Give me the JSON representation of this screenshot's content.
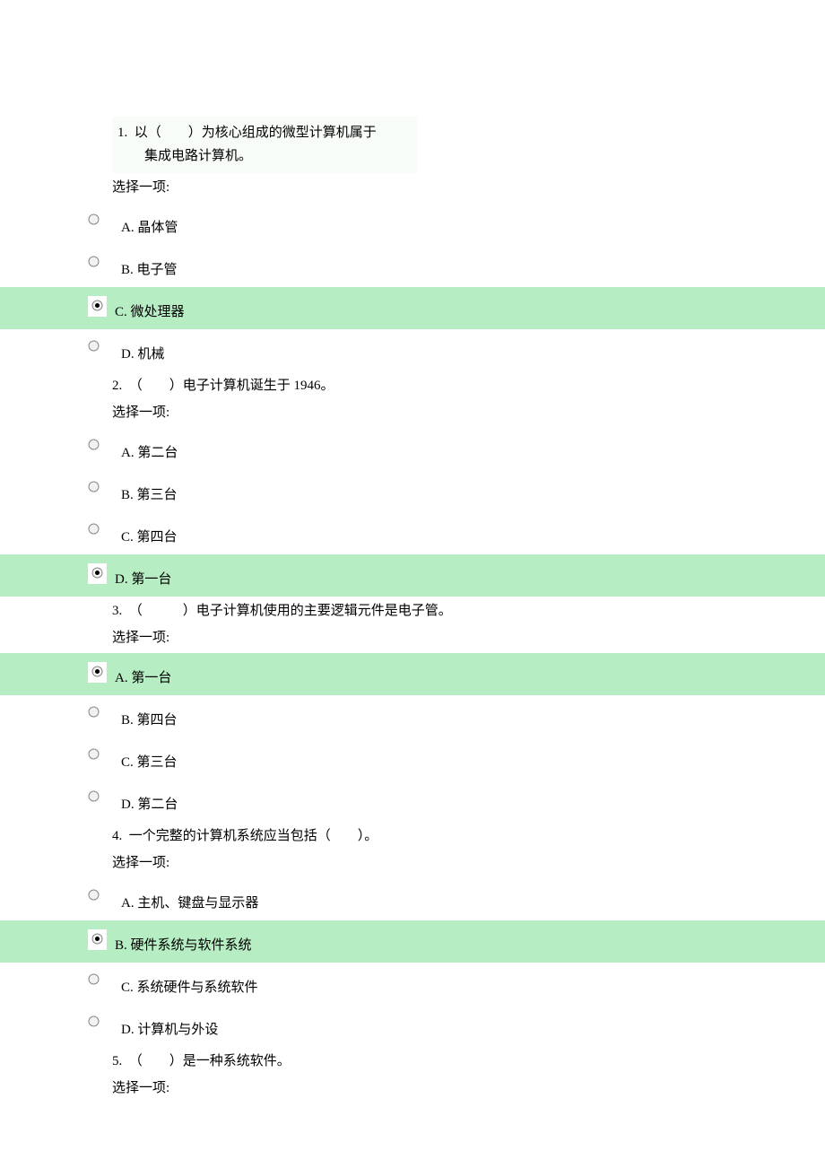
{
  "select_label": "选择一项:",
  "questions": [
    {
      "num": "1.",
      "line1": "以（　　）为核心组成的微型计算机属于",
      "line2": "集成电路计算机。",
      "boxed": true,
      "options": [
        {
          "letter": "A.",
          "text": "晶体管",
          "selected": false
        },
        {
          "letter": "B.",
          "text": "电子管",
          "selected": false
        },
        {
          "letter": "C.",
          "text": "微处理器",
          "selected": true
        },
        {
          "letter": "D.",
          "text": "机械",
          "selected": false
        }
      ]
    },
    {
      "num": "2.",
      "line1": "（　　）电子计算机诞生于 1946。",
      "boxed": false,
      "options": [
        {
          "letter": "A.",
          "text": "第二台",
          "selected": false
        },
        {
          "letter": "B.",
          "text": "第三台",
          "selected": false
        },
        {
          "letter": "C.",
          "text": "第四台",
          "selected": false
        },
        {
          "letter": "D.",
          "text": "第一台",
          "selected": true
        }
      ]
    },
    {
      "num": "3.",
      "line1": "（　　　）电子计算机使用的主要逻辑元件是电子管。",
      "boxed": false,
      "options": [
        {
          "letter": "A.",
          "text": "第一台",
          "selected": true
        },
        {
          "letter": "B.",
          "text": "第四台",
          "selected": false
        },
        {
          "letter": "C.",
          "text": "第三台",
          "selected": false
        },
        {
          "letter": "D.",
          "text": "第二台",
          "selected": false
        }
      ]
    },
    {
      "num": "4.",
      "line1": "一个完整的计算机系统应当包括（　　）。",
      "boxed": false,
      "options": [
        {
          "letter": "A.",
          "text": "主机、键盘与显示器",
          "selected": false
        },
        {
          "letter": "B.",
          "text": "硬件系统与软件系统",
          "selected": true
        },
        {
          "letter": "C.",
          "text": "系统硬件与系统软件",
          "selected": false
        },
        {
          "letter": "D.",
          "text": "计算机与外设",
          "selected": false
        }
      ]
    },
    {
      "num": "5.",
      "line1": "（　　）是一种系统软件。",
      "boxed": false,
      "options": []
    }
  ]
}
